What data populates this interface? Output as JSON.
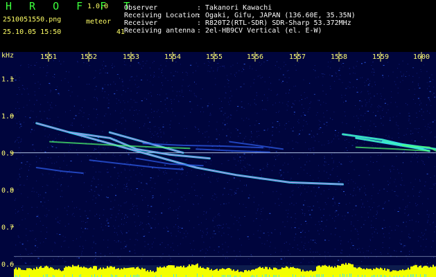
{
  "app": {
    "title": "H R O F F T",
    "version": "1.0.0",
    "filename": "2510051550.png",
    "datetime": "25.10.05 15:50",
    "meteor_label": "meteor",
    "meteor_count": "41"
  },
  "station": [
    {
      "label": "Observer",
      "colon": ":",
      "value": "Takanori Kawachi"
    },
    {
      "label": "Receiving Location",
      "colon": ":",
      "value": "Ogaki, Gifu, JAPAN (136.60E, 35.35N)"
    },
    {
      "label": "Receiver",
      "colon": ":",
      "value": "R820T2(RTL-SDR) SDR-Sharp 53.372MHz"
    },
    {
      "label": "Receiving antenna",
      "colon": ":",
      "value": "2el-HB9CV Vertical (el. E-W)"
    }
  ],
  "chart_data": {
    "type": "heatmap",
    "x": {
      "tick_labels": [
        "1551",
        "1552",
        "1553",
        "1554",
        "1555",
        "1556",
        "1557",
        "1558",
        "1559",
        "1600"
      ],
      "range": [
        "15:50",
        "16:00"
      ]
    },
    "y": {
      "unit": "kHz",
      "tick_labels": [
        "1.1",
        "1.0",
        "0.9",
        "0.8",
        "0.7",
        "0.6"
      ],
      "range": [
        0.6,
        1.15
      ]
    },
    "colors": {
      "background": "#00053d",
      "noise_low": "#1b2ca7",
      "noise_mid": "#2f5ff2",
      "trace_cyan": "#36e4ff",
      "trace_green": "#4eff6f",
      "trace_magenta": "#ff58d6",
      "baseline_yellow": "#f3ff00",
      "reference_line": "#cfe3ff"
    },
    "traces": [
      {
        "kind": "meteor",
        "points": [
          [
            15.4,
            0.98
          ],
          [
            15.46,
            0.95
          ],
          [
            15.52,
            0.92
          ],
          [
            15.58,
            0.89
          ],
          [
            15.64,
            0.86
          ],
          [
            15.7,
            0.84
          ],
          [
            15.78,
            0.82
          ],
          [
            15.86,
            0.815
          ]
        ],
        "strength": "bright"
      },
      {
        "kind": "meteor",
        "points": [
          [
            15.45,
            0.955
          ],
          [
            15.51,
            0.94
          ],
          [
            15.55,
            0.91
          ],
          [
            15.6,
            0.895
          ],
          [
            15.66,
            0.885
          ]
        ],
        "strength": "bright"
      },
      {
        "kind": "meteor",
        "points": [
          [
            15.51,
            0.955
          ],
          [
            15.55,
            0.935
          ],
          [
            15.59,
            0.915
          ],
          [
            15.62,
            0.9
          ]
        ],
        "strength": "bright"
      },
      {
        "kind": "meteor",
        "points": [
          [
            15.42,
            0.93
          ],
          [
            15.47,
            0.925
          ],
          [
            15.52,
            0.92
          ],
          [
            15.58,
            0.915
          ],
          [
            15.63,
            0.912
          ]
        ],
        "strength": "medium"
      },
      {
        "kind": "meteor",
        "points": [
          [
            15.4,
            0.86
          ],
          [
            15.44,
            0.85
          ],
          [
            15.47,
            0.845
          ]
        ],
        "strength": "faint"
      },
      {
        "kind": "meteor",
        "points": [
          [
            15.48,
            0.88
          ],
          [
            15.53,
            0.87
          ],
          [
            15.58,
            0.86
          ],
          [
            15.62,
            0.855
          ]
        ],
        "strength": "faint"
      },
      {
        "kind": "meteor",
        "points": [
          [
            15.55,
            0.885
          ],
          [
            15.6,
            0.87
          ],
          [
            15.65,
            0.865
          ]
        ],
        "strength": "faint"
      },
      {
        "kind": "meteor",
        "points": [
          [
            15.56,
            0.925
          ],
          [
            15.62,
            0.92
          ],
          [
            15.68,
            0.918
          ],
          [
            15.74,
            0.914
          ]
        ],
        "strength": "faint"
      },
      {
        "kind": "meteor",
        "points": [
          [
            15.64,
            0.91
          ],
          [
            15.7,
            0.905
          ],
          [
            15.75,
            0.902
          ]
        ],
        "strength": "faint"
      },
      {
        "kind": "meteor",
        "points": [
          [
            15.69,
            0.93
          ],
          [
            15.73,
            0.92
          ],
          [
            15.77,
            0.91
          ]
        ],
        "strength": "faint"
      },
      {
        "kind": "meteor",
        "points": [
          [
            15.86,
            0.95
          ],
          [
            15.92,
            0.935
          ],
          [
            15.96,
            0.918
          ],
          [
            15.99,
            0.905
          ]
        ],
        "strength": "bright"
      },
      {
        "kind": "meteor",
        "points": [
          [
            15.88,
            0.94
          ],
          [
            15.93,
            0.925
          ],
          [
            15.98,
            0.91
          ]
        ],
        "strength": "bright"
      },
      {
        "kind": "meteor",
        "points": [
          [
            15.92,
            0.93
          ],
          [
            15.96,
            0.92
          ],
          [
            16.0,
            0.91
          ]
        ],
        "strength": "bright"
      },
      {
        "kind": "meteor",
        "points": [
          [
            15.88,
            0.915
          ],
          [
            15.94,
            0.91
          ],
          [
            15.99,
            0.905
          ]
        ],
        "strength": "medium"
      },
      {
        "kind": "meteor",
        "points": [
          [
            15.95,
            0.92
          ],
          [
            15.99,
            0.915
          ],
          [
            16.0,
            0.905
          ]
        ],
        "strength": "medium"
      }
    ],
    "reference_lines": [
      0.9,
      0.62
    ],
    "baseline_level": "0.59"
  }
}
